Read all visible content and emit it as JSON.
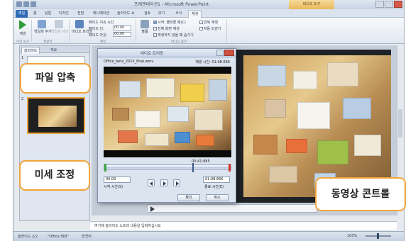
{
  "window": {
    "document_title": "프레젠테이션1 - Microsoft PowerPoint",
    "context_group": "비디오 도구"
  },
  "tabs": [
    {
      "label": "파일"
    },
    {
      "label": "홈"
    },
    {
      "label": "삽입"
    },
    {
      "label": "디자인"
    },
    {
      "label": "전환"
    },
    {
      "label": "애니메이션"
    },
    {
      "label": "슬라이드 쇼"
    },
    {
      "label": "검토"
    },
    {
      "label": "보기"
    },
    {
      "label": "서식"
    },
    {
      "label": "재생"
    }
  ],
  "ribbon": {
    "play_label": "재생",
    "bookmark_add": "책갈피 추가",
    "bookmark_remove": "책갈피 제거",
    "trim_video": "비디오 트리밍",
    "fade_duration": "페이드 지속 시간",
    "fade_in_label": "페이드 인:",
    "fade_in_value": "00.00",
    "fade_out_label": "페이드 아웃:",
    "fade_out_value": "00.00",
    "volume_label": "볼륨",
    "start_label": "시작: 클릭할 때(C)",
    "full_screen": "전체 화면 재생",
    "hide_not_playing": "재생하지 않을 때 숨기기",
    "loop": "반복 재생",
    "rewind": "자동 되감기",
    "group_preview": "미리 보기",
    "group_bookmarks": "책갈피",
    "group_editing": "편집",
    "group_video_options": "비디오 옵션"
  },
  "pane": {
    "tab_slides": "슬라이드",
    "tab_outline": "개요",
    "slide_1": "1",
    "slide_2": "2"
  },
  "notes_placeholder": "여기에 슬라이드 노트의 내용을 입력하십시오",
  "statusbar": {
    "slide_info": "슬라이드 2/2",
    "theme": "\"Office 테마\"",
    "language": "한국어",
    "zoom": "100%"
  },
  "dialog": {
    "title": "비디오 트리밍",
    "filename": "Office_beta_2010_final.wmv",
    "duration": "재생 시간: 01:08.666",
    "current_time": "00:41:985",
    "start_value": "00:00",
    "start_label": "시작 시간(S)",
    "end_value": "01:08.666",
    "end_label": "종료 시간(E)",
    "ok": "확인",
    "cancel": "취소"
  },
  "callouts": {
    "compress": "파일 압축",
    "fine_tune": "미세 조정",
    "video_controls": "동영상 콘트롤"
  },
  "colors": {
    "callout_border": "#f0a43b",
    "file_tab": "#2e6ab6"
  }
}
